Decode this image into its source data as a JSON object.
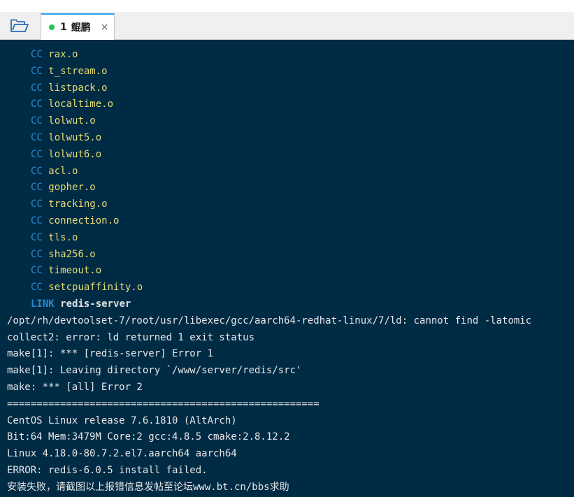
{
  "tabbar": {
    "folder_icon": "folder-open-icon",
    "tab": {
      "number": "1",
      "name": "鲲鹏",
      "status_color": "#22c55e",
      "close_glyph": "×"
    }
  },
  "terminal": {
    "compile_lines": [
      {
        "cmd": "CC",
        "file": "rax.o"
      },
      {
        "cmd": "CC",
        "file": "t_stream.o"
      },
      {
        "cmd": "CC",
        "file": "listpack.o"
      },
      {
        "cmd": "CC",
        "file": "localtime.o"
      },
      {
        "cmd": "CC",
        "file": "lolwut.o"
      },
      {
        "cmd": "CC",
        "file": "lolwut5.o"
      },
      {
        "cmd": "CC",
        "file": "lolwut6.o"
      },
      {
        "cmd": "CC",
        "file": "acl.o"
      },
      {
        "cmd": "CC",
        "file": "gopher.o"
      },
      {
        "cmd": "CC",
        "file": "tracking.o"
      },
      {
        "cmd": "CC",
        "file": "connection.o"
      },
      {
        "cmd": "CC",
        "file": "tls.o"
      },
      {
        "cmd": "CC",
        "file": "sha256.o"
      },
      {
        "cmd": "CC",
        "file": "timeout.o"
      },
      {
        "cmd": "CC",
        "file": "setcpuaffinity.o"
      }
    ],
    "link_line": {
      "cmd": "LINK",
      "target": "redis-server"
    },
    "output_lines": [
      "/opt/rh/devtoolset-7/root/usr/libexec/gcc/aarch64-redhat-linux/7/ld: cannot find -latomic",
      "collect2: error: ld returned 1 exit status",
      "make[1]: *** [redis-server] Error 1",
      "make[1]: Leaving directory `/www/server/redis/src'",
      "make: *** [all] Error 2",
      "=====================================================",
      "CentOS Linux release 7.6.1810 (AltArch)",
      "Bit:64 Mem:3479M Core:2 gcc:4.8.5 cmake:2.8.12.2",
      "Linux 4.18.0-80.7.2.el7.aarch64 aarch64",
      "ERROR: redis-6.0.5 install failed.",
      "安装失败，请截图以上报错信息发帖至论坛www.bt.cn/bbs求助"
    ],
    "colors": {
      "background": "#002b45",
      "cc": "#268bd2",
      "object_file": "#e6db74",
      "plain_text": "#e8e8e8"
    }
  }
}
